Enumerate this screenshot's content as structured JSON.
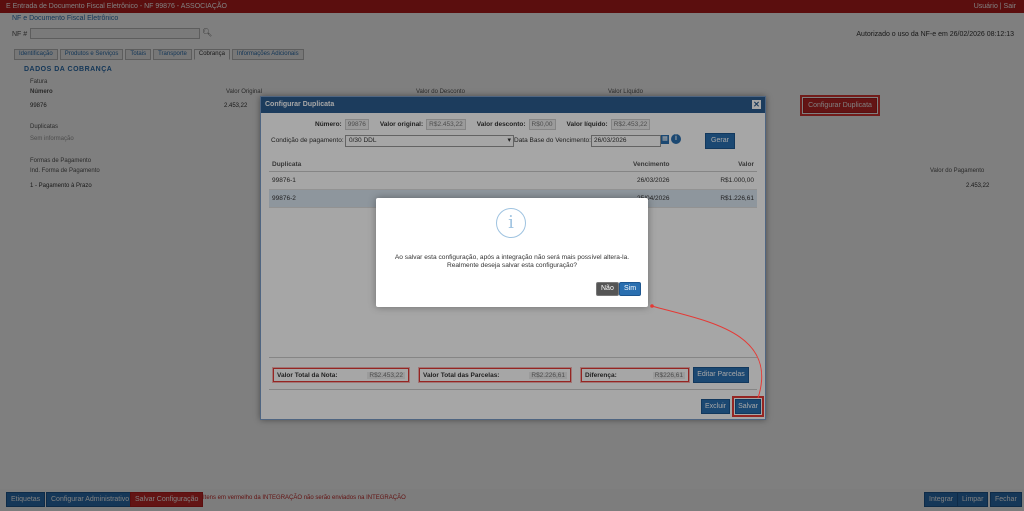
{
  "header": {
    "title": "E Entrada de Documento Fiscal Eletrônico - NF 99876 - ASSOCIAÇÃO",
    "right_text": "Usuário | Sair"
  },
  "subheader": "NF e Documento Fiscal Eletrônico",
  "np_label": "NF #",
  "auth_text": "Autorizado o uso da NF-e em 26/02/2026 08:12:13",
  "tabs": [
    "Identificação",
    "Produtos e Serviços",
    "Totais",
    "Transporte",
    "Cobrança",
    "Informações Adicionais"
  ],
  "section_title": "DADOS DA COBRANÇA",
  "bg_fields": {
    "fatura_label": "Fatura",
    "numero_label": "Número",
    "numero_value": "99876",
    "valor_original_label": "Valor Original",
    "valor_original_value": "2.453,22",
    "valor_desconto_label": "Valor do Desconto",
    "valor_liquido_label": "Valor Líquido",
    "duplicatas_label": "Duplicatas",
    "duplicatas_value": "Sem informação",
    "formas_label": "Formas de Pagamento",
    "ind_label": "Ind. Forma de Pagamento",
    "ind_value": "1 - Pagamento à Prazo",
    "valor_pag_label": "Valor do Pagamento",
    "valor_pag_value": "2.453,22"
  },
  "configurar_duplicata_btn": "Configurar Duplicata",
  "bottom_bar": {
    "buttons_left": [
      "Etiquetas",
      "Configurar Administrativo",
      "Salvar Configuração"
    ],
    "note": "Itens em vermelho da INTEGRAÇÃO não serão enviados na INTEGRAÇÃO",
    "buttons_right": [
      "Integrar",
      "Limpar",
      "Fechar"
    ]
  },
  "modal": {
    "title": "Configurar Duplicata",
    "close_glyph": "✕",
    "numero_label": "Número:",
    "numero_value": "99876",
    "valor_original_label": "Valor original:",
    "valor_original_value": "R$2.453,22",
    "valor_desconto_label": "Valor desconto:",
    "valor_desconto_value": "R$0,00",
    "valor_liquido_label": "Valor líquido:",
    "valor_liquido_value": "R$2.453,22",
    "condicao_label": "Condição de pagamento:",
    "condicao_value": "0/30 DDL",
    "data_base_label": "Data Base do Vencimento:",
    "data_base_value": "26/03/2026",
    "gerar_btn": "Gerar",
    "columns": [
      "Duplicata",
      "Vencimento",
      "Valor"
    ],
    "rows": [
      {
        "duplicata": "99876-1",
        "vencimento": "26/03/2026",
        "valor": "R$1.000,00"
      },
      {
        "duplicata": "99876-2",
        "vencimento": "25/04/2026",
        "valor": "R$1.226,61"
      }
    ],
    "totals": {
      "nota_label": "Valor Total da Nota:",
      "nota_value": "R$2.453,22",
      "parcelas_label": "Valor Total das Parcelas:",
      "parcelas_value": "R$2.226,61",
      "diferenca_label": "Diferença:",
      "diferenca_value": "R$226,61"
    },
    "editar_parcelas_btn": "Editar Parcelas",
    "excluir_btn": "Excluir",
    "salvar_btn": "Salvar"
  },
  "confirm": {
    "icon_glyph": "i",
    "message_line1": "Ao salvar esta configuração, após a integração não será mais possível altera-la.",
    "message_line2": "Realmente deseja salvar esta configuração?",
    "no_btn": "Não",
    "yes_btn": "Sim"
  },
  "colors": {
    "brand_red": "#b71c1c",
    "accent_blue": "#2a6fb0",
    "modal_header": "#2c5d8f",
    "annotation_red": "#e53935"
  }
}
